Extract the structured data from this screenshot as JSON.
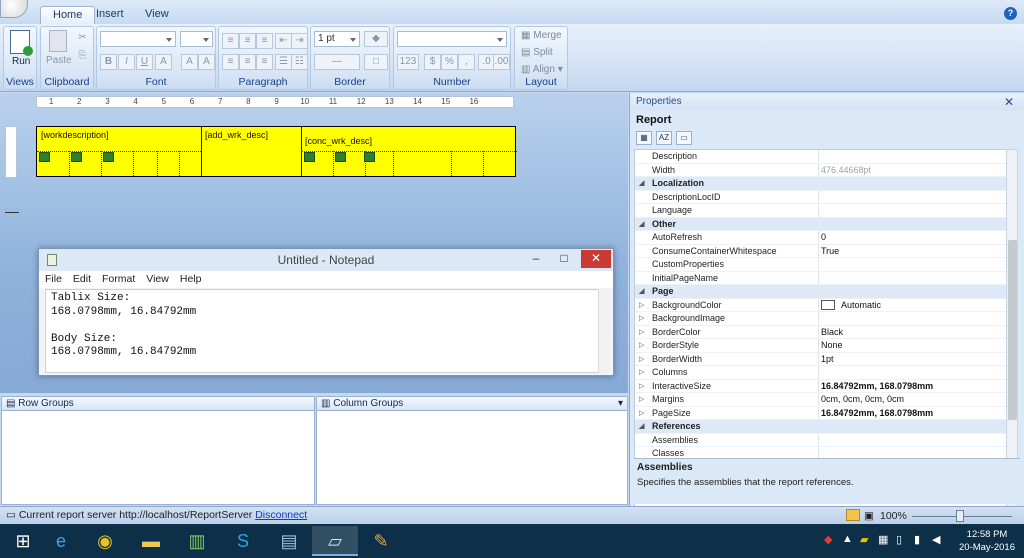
{
  "ribbon": {
    "tabs": [
      "Home",
      "Insert",
      "View"
    ],
    "groups": {
      "views": "Views",
      "clipboard": "Clipboard",
      "font": "Font",
      "paragraph": "Paragraph",
      "border": "Border",
      "number": "Number",
      "layout": "Layout"
    },
    "run_label": "Run",
    "paste_label": "Paste",
    "border_width": "1 pt",
    "merge_label": "Merge",
    "split_label": "Split",
    "align_label": "Align"
  },
  "ruler": [
    "1",
    "2",
    "3",
    "4",
    "5",
    "6",
    "7",
    "8",
    "9",
    "10",
    "11",
    "12",
    "13",
    "14",
    "15",
    "16"
  ],
  "tablix": {
    "cells": [
      "[workdescription]",
      "[add_wrk_desc]",
      "[conc_wrk_desc]"
    ]
  },
  "notepad": {
    "title": "Untitled - Notepad",
    "menu": [
      "File",
      "Edit",
      "Format",
      "View",
      "Help"
    ],
    "text": "Tablix Size:\n168.0798mm, 16.84792mm\n\nBody Size:\n168.0798mm, 16.84792mm"
  },
  "panes": {
    "row_groups": "Row Groups",
    "column_groups": "Column Groups"
  },
  "properties": {
    "header": "Properties",
    "object": "Report",
    "rows": [
      {
        "type": "prop",
        "name": "Description",
        "value": ""
      },
      {
        "type": "prop",
        "name": "Width",
        "value": "476.44668pt",
        "style": "gray"
      },
      {
        "type": "cat",
        "name": "Localization"
      },
      {
        "type": "prop",
        "name": "DescriptionLocID",
        "value": ""
      },
      {
        "type": "prop",
        "name": "Language",
        "value": ""
      },
      {
        "type": "cat",
        "name": "Other"
      },
      {
        "type": "prop",
        "name": "AutoRefresh",
        "value": "0"
      },
      {
        "type": "prop",
        "name": "ConsumeContainerWhitespace",
        "value": "True"
      },
      {
        "type": "prop",
        "name": "CustomProperties",
        "value": ""
      },
      {
        "type": "prop",
        "name": "InitialPageName",
        "value": ""
      },
      {
        "type": "cat",
        "name": "Page"
      },
      {
        "type": "prop",
        "name": "BackgroundColor",
        "value": "Automatic",
        "swatch": true,
        "expand": true
      },
      {
        "type": "prop",
        "name": "BackgroundImage",
        "value": "",
        "expand": true
      },
      {
        "type": "prop",
        "name": "BorderColor",
        "value": "Black",
        "expand": true
      },
      {
        "type": "prop",
        "name": "BorderStyle",
        "value": "None",
        "expand": true
      },
      {
        "type": "prop",
        "name": "BorderWidth",
        "value": "1pt",
        "expand": true
      },
      {
        "type": "prop",
        "name": "Columns",
        "value": "",
        "expand": true
      },
      {
        "type": "prop",
        "name": "InteractiveSize",
        "value": "16.84792mm, 168.0798mm",
        "style": "bold",
        "expand": true
      },
      {
        "type": "prop",
        "name": "Margins",
        "value": "0cm, 0cm, 0cm, 0cm",
        "expand": true
      },
      {
        "type": "prop",
        "name": "PageSize",
        "value": "16.84792mm, 168.0798mm",
        "style": "bold",
        "expand": true
      },
      {
        "type": "cat",
        "name": "References"
      },
      {
        "type": "prop",
        "name": "Assemblies",
        "value": ""
      },
      {
        "type": "prop",
        "name": "Classes",
        "value": ""
      }
    ],
    "description_title": "Assemblies",
    "description_text": "Specifies the assemblies that the report references."
  },
  "status": {
    "prefix": "Current report server http://localhost/ReportServer",
    "disconnect": "Disconnect",
    "zoom": "100%"
  },
  "taskbar": {
    "time": "12:58 PM",
    "date": "20-May-2016"
  }
}
